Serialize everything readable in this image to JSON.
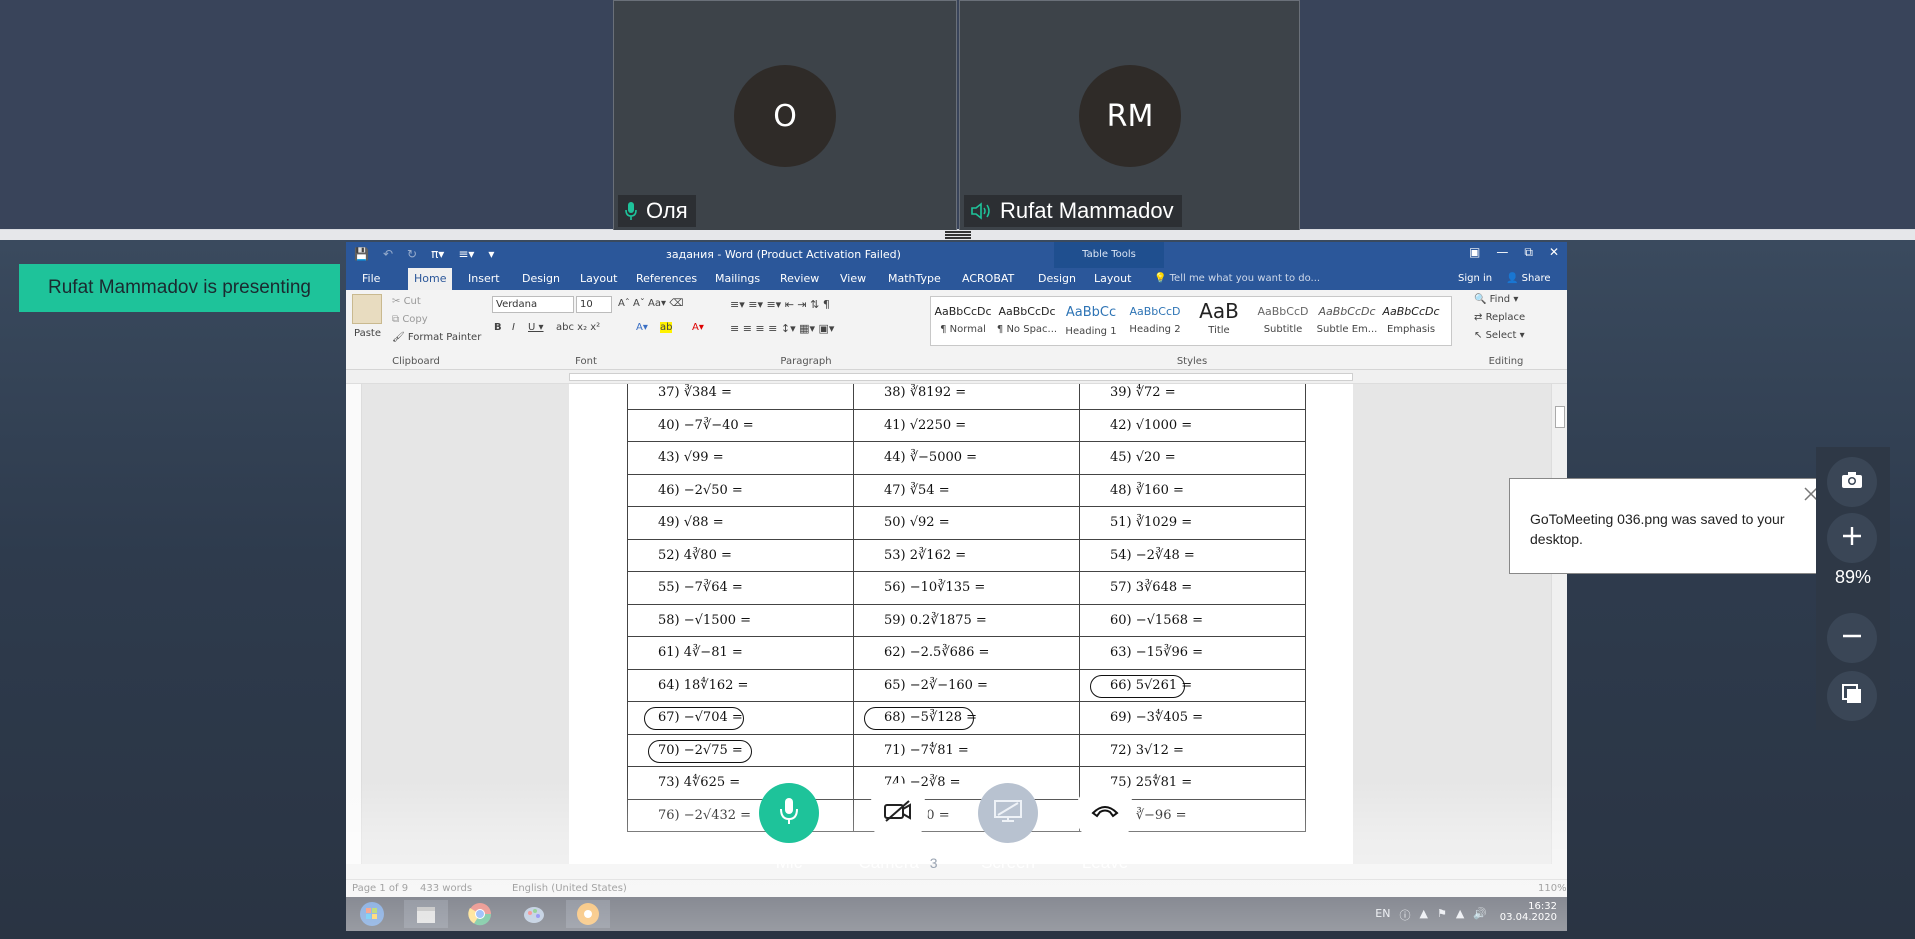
{
  "participants": [
    {
      "initials": "O",
      "name": "Оля",
      "audio": "mic-icon"
    },
    {
      "initials": "RM",
      "name": "Rufat Mammadov",
      "audio": "speaker-icon"
    }
  ],
  "presenter_badge": "Rufat Mammadov is presenting",
  "word": {
    "title": "задания - Word (Product Activation Failed)",
    "table_tools": "Table Tools",
    "tabs": [
      "File",
      "Home",
      "Insert",
      "Design",
      "Layout",
      "References",
      "Mailings",
      "Review",
      "View",
      "MathType",
      "ACROBAT",
      "Design",
      "Layout"
    ],
    "active_tab": "Home",
    "tell_me": "Tell me what you want to do...",
    "sign_in": "Sign in",
    "share": "Share",
    "clipboard": {
      "paste": "Paste",
      "cut": "Cut",
      "copy": "Copy",
      "format_painter": "Format Painter",
      "label": "Clipboard"
    },
    "font": {
      "name": "Verdana",
      "size": "10",
      "label": "Font"
    },
    "paragraph_label": "Paragraph",
    "styles_label": "Styles",
    "styles": [
      {
        "sample": "AaBbCcDc",
        "name": "¶ Normal"
      },
      {
        "sample": "AaBbCcDc",
        "name": "¶ No Spac..."
      },
      {
        "sample": "AaBbCc",
        "name": "Heading 1"
      },
      {
        "sample": "AaBbCcD",
        "name": "Heading 2"
      },
      {
        "sample": "AaB",
        "name": "Title"
      },
      {
        "sample": "AaBbCcD",
        "name": "Subtitle"
      },
      {
        "sample": "AaBbCcDc",
        "name": "Subtle Em..."
      },
      {
        "sample": "AaBbCcDc",
        "name": "Emphasis"
      }
    ],
    "editing": {
      "find": "Find",
      "replace": "Replace",
      "select": "Select",
      "label": "Editing"
    },
    "table_rows": [
      [
        "37) ∛384 =",
        "38) ∛8192 =",
        "39) ∜72 ="
      ],
      [
        "40) −7∛−40 =",
        "41) √2250 =",
        "42) √1000 ="
      ],
      [
        "43) √99 =",
        "44) ∛−5000 =",
        "45) √20 ="
      ],
      [
        "46) −2√50 =",
        "47) ∛54 =",
        "48) ∛160 ="
      ],
      [
        "49) √88 =",
        "50) √92 =",
        "51) ∛1029 ="
      ],
      [
        "52) 4∛80 =",
        "53) 2∛162 =",
        "54) −2∛48 ="
      ],
      [
        "55) −7∛64 =",
        "56) −10∛135 =",
        "57)  3∛648 ="
      ],
      [
        "58) −√1500 =",
        "59)  0.2∛1875 =",
        "60) −√1568 ="
      ],
      [
        "61) 4∛−81 =",
        "62) −2.5∛686 =",
        "63) −15∛96 ="
      ],
      [
        "64) 18∜162 =",
        "65) −2∛−160 =",
        "66) 5√261 ="
      ],
      [
        "67) −√704 =",
        "68) −5∛128 =",
        "69) −3∜405 ="
      ],
      [
        "70) −2√75 =",
        "71) −7∜81 =",
        "72) 3√12 ="
      ],
      [
        "73) 4∜625 =",
        "74) −2∛8 =",
        "75) 25∜81 ="
      ],
      [
        "76) −2√432 =",
        "77) ∛80 =",
        "78) ∛−96 ="
      ]
    ],
    "status": {
      "page": "Page 1 of 9",
      "words": "433 words",
      "language": "English (United States)",
      "zoom": "110%"
    }
  },
  "taskbar": {
    "lang": "EN",
    "time": "16:32",
    "date": "03.04.2020"
  },
  "toast": {
    "message": "GoToMeeting 036.png was saved to your desktop."
  },
  "side_controls": {
    "zoom": "89%"
  },
  "dock": [
    {
      "label": "Mic",
      "count": ""
    },
    {
      "label": "Camera",
      "count": "3"
    },
    {
      "label": "Screen",
      "count": ""
    },
    {
      "label": "Leave",
      "count": ""
    }
  ],
  "colors": {
    "accent": "#1ec39a",
    "word_blue": "#2b579a",
    "leave": "#ffffff"
  }
}
